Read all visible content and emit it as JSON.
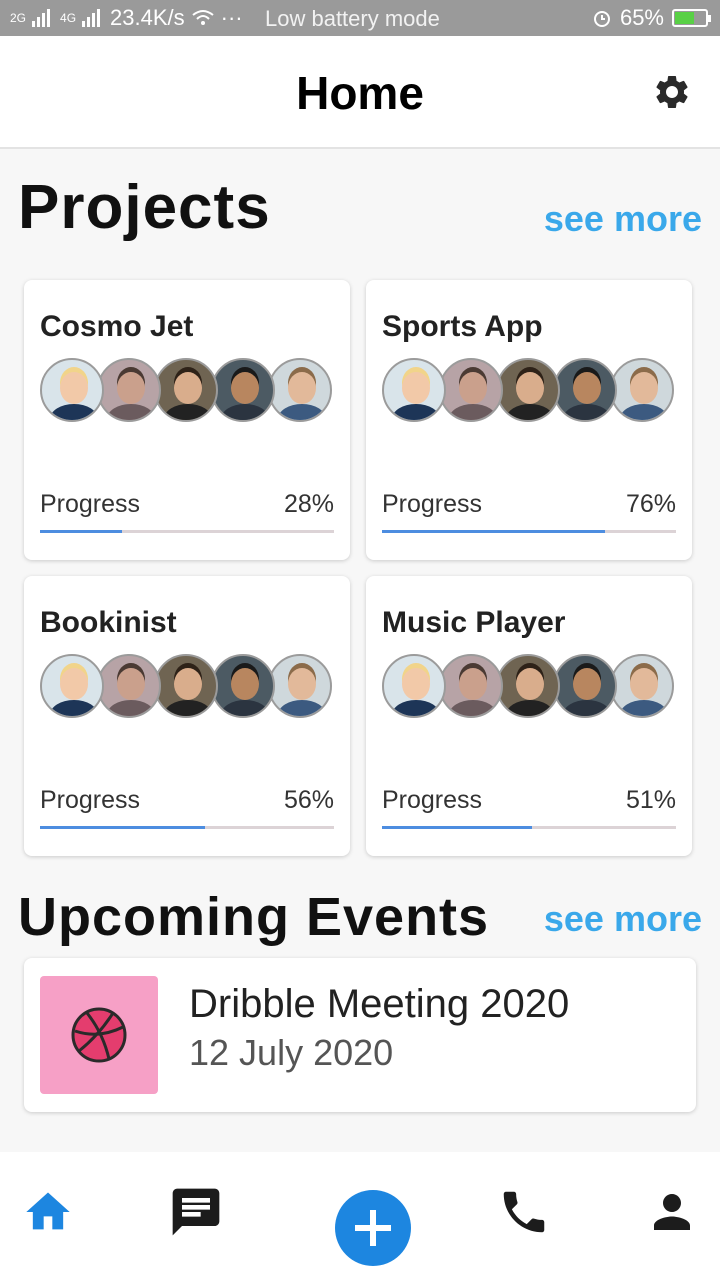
{
  "status_bar": {
    "network_1": "2G",
    "network_2": "4G",
    "speed": "23.4K/s",
    "dots": "···",
    "mode": "Low battery mode",
    "battery": "65%"
  },
  "header": {
    "title": "Home",
    "settings_icon": "gear-icon"
  },
  "projects": {
    "title": "Projects",
    "see_more": "see more",
    "progress_label": "Progress",
    "items": [
      {
        "name": "Cosmo Jet",
        "progress_text": "28%",
        "progress": 0.28
      },
      {
        "name": "Sports App",
        "progress_text": "76%",
        "progress": 0.76
      },
      {
        "name": "Bookinist",
        "progress_text": "56%",
        "progress": 0.56
      },
      {
        "name": "Music Player",
        "progress_text": "51%",
        "progress": 0.51
      }
    ]
  },
  "events": {
    "title": "Upcoming Events",
    "see_more": "see more",
    "items": [
      {
        "name": "Dribble Meeting 2020",
        "date": "12 July 2020",
        "icon": "dribbble-icon"
      }
    ]
  },
  "bottom_nav": {
    "items": [
      "home-icon",
      "chat-icon",
      "add-icon",
      "phone-icon",
      "person-icon"
    ],
    "active": "home-icon"
  },
  "colors": {
    "accent": "#3aa8ea",
    "active_nav": "#1d86e0",
    "progress_fill": "#4d8de0",
    "event_thumb": "#f6a0c6"
  }
}
